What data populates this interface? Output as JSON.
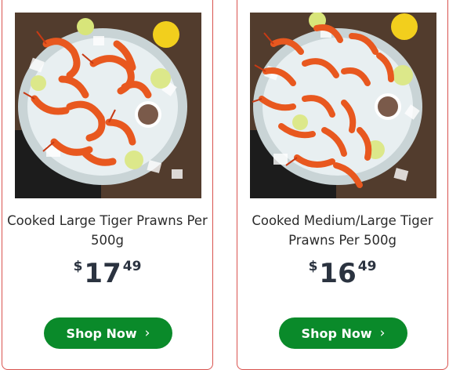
{
  "products": [
    {
      "name": "Cooked Large Tiger Prawns Per 500g",
      "currency": "$",
      "price_dollars": "17",
      "price_cents": "49",
      "button_label": "Shop Now",
      "button_icon": "chevron-right-icon"
    },
    {
      "name": "Cooked Medium/Large Tiger Prawns Per 500g",
      "currency": "$",
      "price_dollars": "16",
      "price_cents": "49",
      "button_label": "Shop Now",
      "button_icon": "chevron-right-icon"
    }
  ],
  "colors": {
    "card_border": "#d9534f",
    "button_bg": "#0a8a2a",
    "price_text": "#2b3340",
    "name_text": "#2b2b2b"
  }
}
